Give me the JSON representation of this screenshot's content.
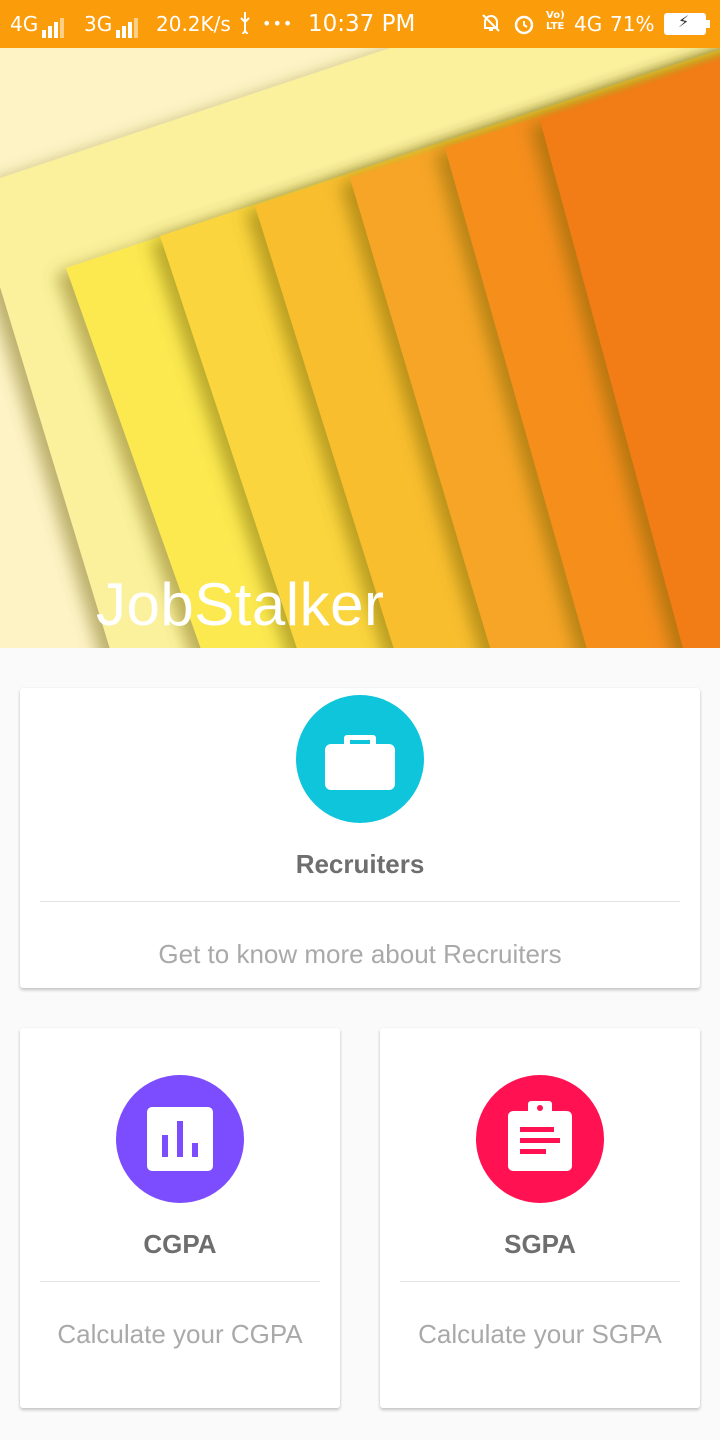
{
  "status_bar": {
    "net1": "4G",
    "net2": "3G",
    "speed": "20.2K/s",
    "dots": "•••",
    "time": "10:37 PM",
    "volte_top": "Vo)",
    "volte_bottom": "LTE",
    "net3": "4G",
    "battery": "71%"
  },
  "header": {
    "title": "JobStalker",
    "colors": [
      "#fdf3c4",
      "#fbf19c",
      "#fce94f",
      "#fbd53c",
      "#f9be2f",
      "#f7a526",
      "#f68e1e",
      "#f27d18"
    ]
  },
  "cards": {
    "recruiters": {
      "title": "Recruiters",
      "subtitle": "Get to know more about Recruiters",
      "icon": "briefcase-icon",
      "color": "#0ec5dc"
    },
    "cgpa": {
      "title": "CGPA",
      "subtitle": "Calculate your CGPA",
      "icon": "bar-chart-icon",
      "color": "#7c4dff"
    },
    "sgpa": {
      "title": "SGPA",
      "subtitle": "Calculate your SGPA",
      "icon": "clipboard-icon",
      "color": "#ff1152"
    }
  }
}
